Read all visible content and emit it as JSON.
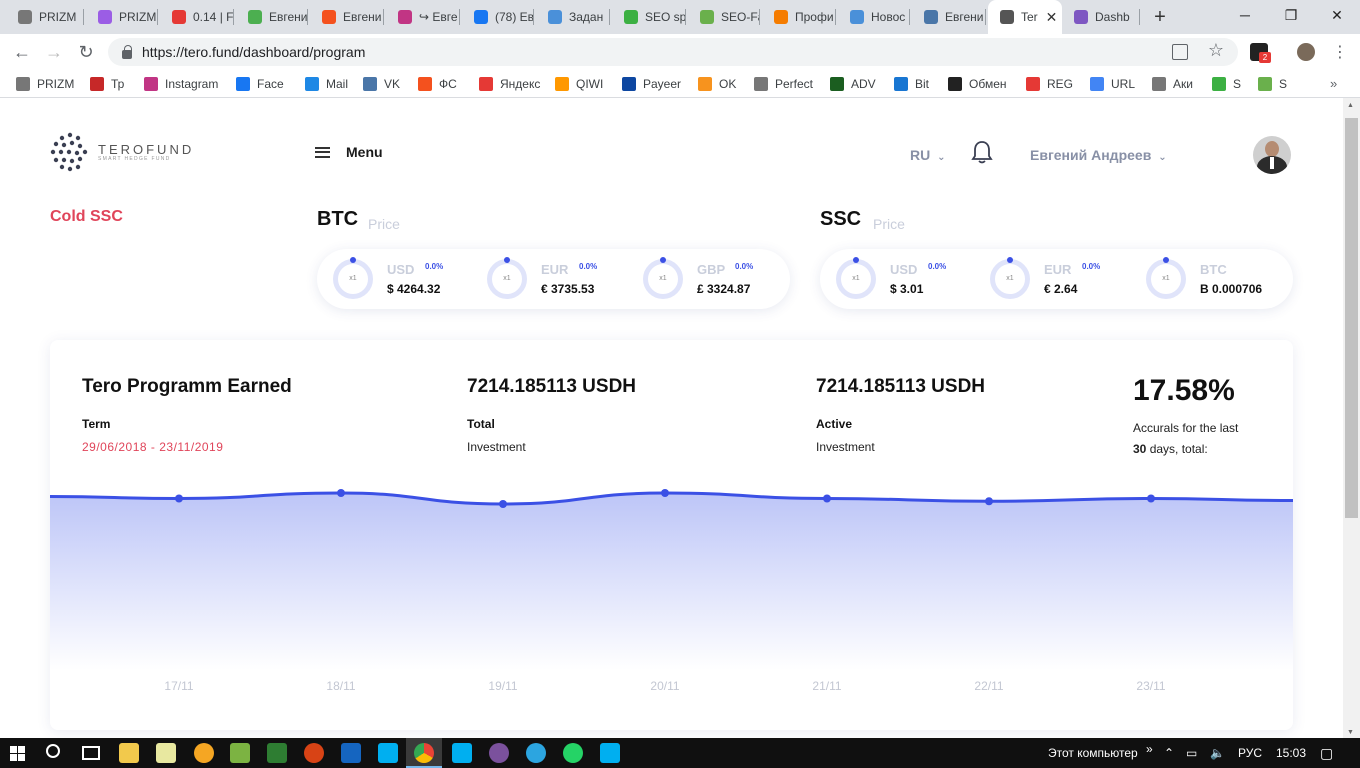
{
  "browser": {
    "tabs": [
      {
        "label": "PRIZM",
        "color": "#777"
      },
      {
        "label": "PRIZM",
        "color": "#9b5de5"
      },
      {
        "label": "0.14 | F",
        "color": "#e53935"
      },
      {
        "label": "Евгени",
        "color": "#4caf50"
      },
      {
        "label": "Евгени",
        "color": "#f4511e"
      },
      {
        "label": "↪ Евге",
        "color": "#c13584"
      },
      {
        "label": "(78) Ев",
        "color": "#1877f2"
      },
      {
        "label": "Задан",
        "color": "#4a90d9"
      },
      {
        "label": "SEO sp",
        "color": "#3cb043"
      },
      {
        "label": "SEO-Fa",
        "color": "#6ab04c"
      },
      {
        "label": "Профи",
        "color": "#f57c00"
      },
      {
        "label": "Новос",
        "color": "#4a90d9"
      },
      {
        "label": "Евгени",
        "color": "#4a76a8"
      },
      {
        "label": "Ter",
        "color": "#555",
        "active": true
      },
      {
        "label": "Dashb",
        "color": "#7e57c2"
      }
    ],
    "url": "https://tero.fund/dashboard/program",
    "bookmarks": [
      {
        "label": "PRIZM",
        "color": "#777"
      },
      {
        "label": "Тр",
        "color": "#c62828"
      },
      {
        "label": "Instagram",
        "color": "#c13584"
      },
      {
        "label": "Face",
        "color": "#1877f2"
      },
      {
        "label": "Mail",
        "color": "#1e88e5"
      },
      {
        "label": "VK",
        "color": "#4a76a8"
      },
      {
        "label": "ФС",
        "color": "#f4511e"
      },
      {
        "label": "Яндекс",
        "color": "#e53935"
      },
      {
        "label": "QIWI",
        "color": "#ff9800"
      },
      {
        "label": "Payeer",
        "color": "#0d47a1"
      },
      {
        "label": "OK",
        "color": "#f7931e"
      },
      {
        "label": "Perfect",
        "color": "#777"
      },
      {
        "label": "ADV",
        "color": "#1b5e20"
      },
      {
        "label": "Bit",
        "color": "#1976d2"
      },
      {
        "label": "Обмен",
        "color": "#222"
      },
      {
        "label": "REG",
        "color": "#e53935"
      },
      {
        "label": "URL",
        "color": "#4285f4"
      },
      {
        "label": "Аки",
        "color": "#777"
      },
      {
        "label": "S",
        "color": "#3cb043"
      },
      {
        "label": "S",
        "color": "#6ab04c"
      }
    ]
  },
  "header": {
    "logo_name": "TEROFUND",
    "logo_tagline": "SMART HEDGE FUND",
    "menu_label": "Menu",
    "language": "RU",
    "user_name": "Евгений Андреев"
  },
  "cold_ssc": "Cold SSC",
  "btc": {
    "title": "BTC",
    "subtitle": "Price",
    "rates": [
      {
        "currency": "USD",
        "change": "0.0%",
        "multiplier": "x1",
        "value": "$ 4264.32"
      },
      {
        "currency": "EUR",
        "change": "0.0%",
        "multiplier": "x1",
        "value": "€ 3735.53"
      },
      {
        "currency": "GBP",
        "change": "0.0%",
        "multiplier": "x1",
        "value": "£ 3324.87"
      }
    ]
  },
  "ssc": {
    "title": "SSC",
    "subtitle": "Price",
    "rates": [
      {
        "currency": "USD",
        "change": "0.0%",
        "multiplier": "x1",
        "value": "$ 3.01"
      },
      {
        "currency": "EUR",
        "change": "0.0%",
        "multiplier": "x1",
        "value": "€ 2.64"
      },
      {
        "currency": "BTC",
        "change": "",
        "multiplier": "x1",
        "value": "B 0.000706"
      }
    ]
  },
  "program": {
    "title": "Tero Programm Earned",
    "term_label": "Term",
    "term_dates": "29/06/2018 - 23/11/2019",
    "total_amount": "7214.185113 USDH",
    "total_label": "Total",
    "total_sub": "Investment",
    "active_amount": "7214.185113 USDH",
    "active_label": "Active",
    "active_sub": "Investment",
    "accrual_percent": "17.58%",
    "accrual_text_1": "Accurals for the last",
    "accrual_days": "30",
    "accrual_text_2": "days, total:"
  },
  "chart_data": {
    "type": "area",
    "categories": [
      "17/11",
      "18/11",
      "19/11",
      "20/11",
      "21/11",
      "22/11",
      "23/11"
    ],
    "values": [
      7214.18,
      7214.19,
      7214.17,
      7214.19,
      7214.18,
      7214.175,
      7214.18
    ],
    "title": "",
    "xlabel": "",
    "ylabel": "",
    "grid": false,
    "line_color": "#3b50e5",
    "fill_color": "#b9c2f7"
  },
  "taskbar": {
    "computer_label": "Этот компьютер",
    "lang": "РУС",
    "time": "15:03"
  }
}
